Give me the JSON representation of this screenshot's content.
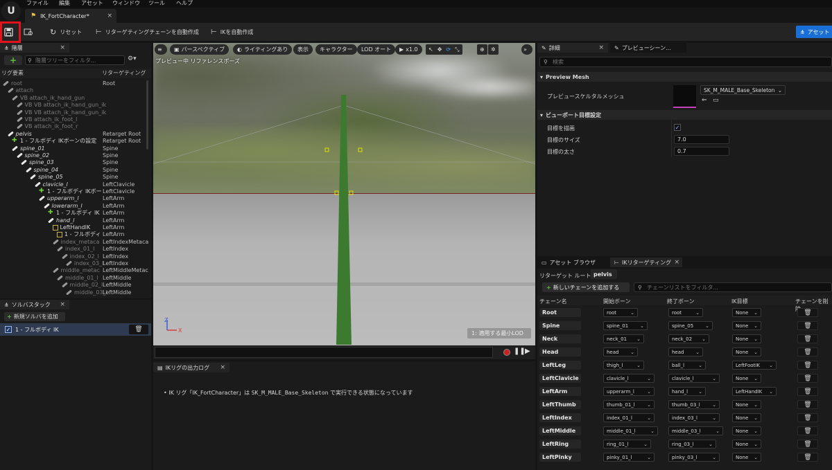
{
  "menu": [
    "ファイル",
    "編集",
    "アセット",
    "ウィンドウ",
    "ツール",
    "ヘルプ"
  ],
  "doc_tab": {
    "title": "IK_FortCharacter*"
  },
  "toolbar": {
    "reset": "リセット",
    "auto_chain": "リターゲティングチェーンを自動作成",
    "auto_ik": "IKを自動作成",
    "asset": "アセット"
  },
  "hierarchy": {
    "title": "階層",
    "search_placeholder": "階層ツリーをフィルタ...",
    "col_element": "リグ要素",
    "col_chain": "リターゲティング",
    "rows": [
      {
        "name": "root",
        "chain": "Root",
        "indent": 0,
        "kind": "bone",
        "dim": true
      },
      {
        "name": "attach",
        "chain": "",
        "indent": 1,
        "kind": "bone",
        "dim": true
      },
      {
        "name": "VB attach_ik_hand_gun",
        "chain": "",
        "indent": 2,
        "kind": "bone",
        "dim": true
      },
      {
        "name": "VB VB attach_ik_hand_gun_ik",
        "chain": "",
        "indent": 3,
        "kind": "bone",
        "dim": true
      },
      {
        "name": "VB VB attach_ik_hand_gun_ik",
        "chain": "",
        "indent": 3,
        "kind": "bone",
        "dim": true
      },
      {
        "name": "VB attach_ik_foot_l",
        "chain": "",
        "indent": 3,
        "kind": "bone",
        "dim": true
      },
      {
        "name": "VB attach_ik_foot_r",
        "chain": "",
        "indent": 3,
        "kind": "bone",
        "dim": true
      },
      {
        "name": "pelvis",
        "chain": "Retarget Root",
        "indent": 1,
        "kind": "bone",
        "dim": false
      },
      {
        "name": "1 - フルボディ IKボーンの設定",
        "chain": "Retarget Root",
        "indent": 2,
        "kind": "solver",
        "dim": false
      },
      {
        "name": "spine_01",
        "chain": "Spine",
        "indent": 2,
        "kind": "bone",
        "dim": false
      },
      {
        "name": "spine_02",
        "chain": "Spine",
        "indent": 3,
        "kind": "bone",
        "dim": false
      },
      {
        "name": "spine_03",
        "chain": "Spine",
        "indent": 4,
        "kind": "bone",
        "dim": false
      },
      {
        "name": "spine_04",
        "chain": "Spine",
        "indent": 5,
        "kind": "bone",
        "dim": false
      },
      {
        "name": "spine_05",
        "chain": "Spine",
        "indent": 6,
        "kind": "bone",
        "dim": false
      },
      {
        "name": "clavicle_l",
        "chain": "LeftClavicle",
        "indent": 7,
        "kind": "bone",
        "dim": false
      },
      {
        "name": "1 - フルボディ IKボー",
        "chain": "LeftClavicle",
        "indent": 8,
        "kind": "solver",
        "dim": false
      },
      {
        "name": "upperarm_l",
        "chain": "LeftArm",
        "indent": 8,
        "kind": "bone",
        "dim": false
      },
      {
        "name": "lowerarm_l",
        "chain": "LeftArm",
        "indent": 9,
        "kind": "bone",
        "dim": false
      },
      {
        "name": "1 - フルボディ IK",
        "chain": "LeftArm",
        "indent": 10,
        "kind": "solver",
        "dim": false
      },
      {
        "name": "hand_l",
        "chain": "LeftArm",
        "indent": 10,
        "kind": "bone",
        "dim": false
      },
      {
        "name": "LeftHandIK",
        "chain": "LeftArm",
        "indent": 11,
        "kind": "goal",
        "dim": false
      },
      {
        "name": "1 - フルボディ",
        "chain": "LeftArm",
        "indent": 12,
        "kind": "goal",
        "dim": false
      },
      {
        "name": "index_metaca",
        "chain": "LeftIndexMetaca",
        "indent": 11,
        "kind": "bone",
        "dim": true
      },
      {
        "name": "index_01_l",
        "chain": "LeftIndex",
        "indent": 12,
        "kind": "bone",
        "dim": true
      },
      {
        "name": "index_02_l",
        "chain": "LeftIndex",
        "indent": 13,
        "kind": "bone",
        "dim": true
      },
      {
        "name": "index_03_l",
        "chain": "LeftIndex",
        "indent": 14,
        "kind": "bone",
        "dim": true
      },
      {
        "name": "middle_metac",
        "chain": "LeftMiddleMetac",
        "indent": 11,
        "kind": "bone",
        "dim": true
      },
      {
        "name": "middle_01_l",
        "chain": "LeftMiddle",
        "indent": 12,
        "kind": "bone",
        "dim": true
      },
      {
        "name": "middle_02_l",
        "chain": "LeftMiddle",
        "indent": 13,
        "kind": "bone",
        "dim": true
      },
      {
        "name": "middle_03_l",
        "chain": "LeftMiddle",
        "indent": 14,
        "kind": "bone",
        "dim": true
      }
    ]
  },
  "solver_stack": {
    "title": "ソルバスタック",
    "add": "新規ソルバを追加",
    "item": "1 - フルボディ IK"
  },
  "viewport": {
    "menu": "≡",
    "perspective": "パースペクティブ",
    "lighting": "ライティングあり",
    "show": "表示",
    "character": "キャラクター",
    "lod": "LOD オート",
    "speed": "x1.0",
    "preview_label": "プレビュー中 リファレンスポーズ",
    "scale_label": "1: 適用する最小LOD",
    "axis_z": "Z",
    "axis_x": "X"
  },
  "output_log": {
    "title": "IKリグの出力ログ",
    "message_prefix": "IK リグ「IK_FortCharacter」は ",
    "message_mesh": "SK_M_MALE_Base_Skeleton",
    "message_suffix": " で実行できる状態になっています"
  },
  "details": {
    "tab_details": "詳細",
    "tab_preview": "プレビューシーン...",
    "search_placeholder": "検索",
    "section_preview_mesh": "Preview Mesh",
    "preview_mesh_label": "プレビュースケルタルメッシュ",
    "preview_mesh_value": "SK_M_MALE_Base_Skeleton",
    "section_goal": "ビューポート目標設定",
    "draw_goal_label": "目標を描画",
    "goal_size_label": "目標のサイズ",
    "goal_size_value": "7.0",
    "goal_thickness_label": "目標の太さ",
    "goal_thickness_value": "0.7"
  },
  "retarget": {
    "tab_asset_browser": "アセット ブラウザ",
    "tab_ik_retarget": "IKリターゲティング",
    "root_label": "リターゲット ルート:",
    "root_value": "pelvis",
    "add_chain": "新しいチェーンを追加する",
    "search_placeholder": "チェーンリストをフィルタ...",
    "col_chain": "チェーン名",
    "col_start": "開始ボーン",
    "col_end": "終了ボーン",
    "col_goal": "IK目標",
    "col_delete": "チェーンを削除",
    "chains": [
      {
        "name": "Root",
        "start": "root",
        "end": "root",
        "goal": "None"
      },
      {
        "name": "Spine",
        "start": "spine_01",
        "end": "spine_05",
        "goal": "None"
      },
      {
        "name": "Neck",
        "start": "neck_01",
        "end": "neck_02",
        "goal": "None"
      },
      {
        "name": "Head",
        "start": "head",
        "end": "head",
        "goal": "None"
      },
      {
        "name": "LeftLeg",
        "start": "thigh_l",
        "end": "ball_l",
        "goal": "LeftFootIK"
      },
      {
        "name": "LeftClavicle",
        "start": "clavicle_l",
        "end": "clavicle_l",
        "goal": "None"
      },
      {
        "name": "LeftArm",
        "start": "upperarm_l",
        "end": "hand_l",
        "goal": "LeftHandIK"
      },
      {
        "name": "LeftThumb",
        "start": "thumb_01_l",
        "end": "thumb_03_l",
        "goal": "None"
      },
      {
        "name": "LeftIndex",
        "start": "index_01_l",
        "end": "index_03_l",
        "goal": "None"
      },
      {
        "name": "LeftMiddle",
        "start": "middle_01_l",
        "end": "middle_03_l",
        "goal": "None"
      },
      {
        "name": "LeftRing",
        "start": "ring_01_l",
        "end": "ring_03_l",
        "goal": "None"
      },
      {
        "name": "LeftPinky",
        "start": "pinky_01_l",
        "end": "pinky_03_l",
        "goal": "None"
      }
    ]
  },
  "colors": {
    "accent": "#1a6fd6",
    "highlight": "#e3131b",
    "bone_green": "#3f7f2f"
  }
}
